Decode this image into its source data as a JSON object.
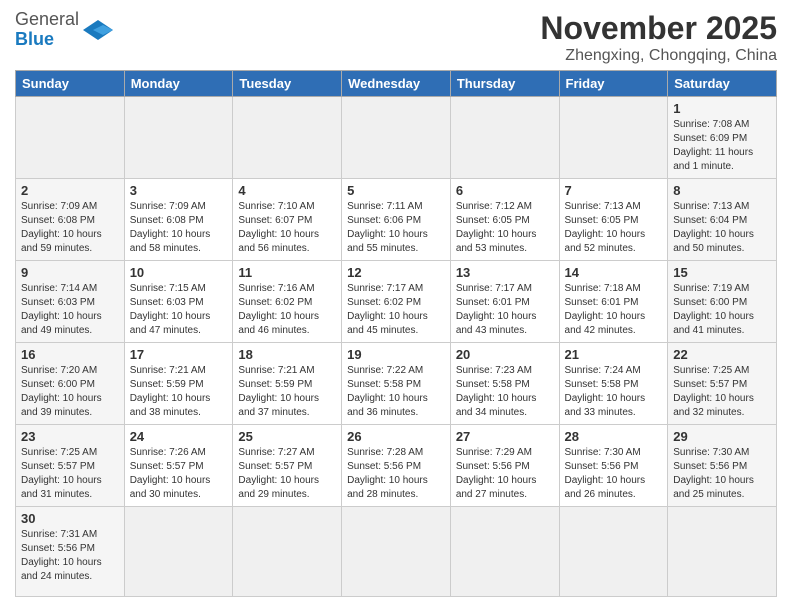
{
  "header": {
    "logo_general": "General",
    "logo_blue": "Blue",
    "title": "November 2025",
    "subtitle": "Zhengxing, Chongqing, China"
  },
  "days_of_week": [
    "Sunday",
    "Monday",
    "Tuesday",
    "Wednesday",
    "Thursday",
    "Friday",
    "Saturday"
  ],
  "weeks": [
    [
      {
        "num": "",
        "info": ""
      },
      {
        "num": "",
        "info": ""
      },
      {
        "num": "",
        "info": ""
      },
      {
        "num": "",
        "info": ""
      },
      {
        "num": "",
        "info": ""
      },
      {
        "num": "",
        "info": ""
      },
      {
        "num": "1",
        "info": "Sunrise: 7:08 AM\nSunset: 6:09 PM\nDaylight: 11 hours\nand 1 minute."
      }
    ],
    [
      {
        "num": "2",
        "info": "Sunrise: 7:09 AM\nSunset: 6:08 PM\nDaylight: 10 hours\nand 59 minutes."
      },
      {
        "num": "3",
        "info": "Sunrise: 7:09 AM\nSunset: 6:08 PM\nDaylight: 10 hours\nand 58 minutes."
      },
      {
        "num": "4",
        "info": "Sunrise: 7:10 AM\nSunset: 6:07 PM\nDaylight: 10 hours\nand 56 minutes."
      },
      {
        "num": "5",
        "info": "Sunrise: 7:11 AM\nSunset: 6:06 PM\nDaylight: 10 hours\nand 55 minutes."
      },
      {
        "num": "6",
        "info": "Sunrise: 7:12 AM\nSunset: 6:05 PM\nDaylight: 10 hours\nand 53 minutes."
      },
      {
        "num": "7",
        "info": "Sunrise: 7:13 AM\nSunset: 6:05 PM\nDaylight: 10 hours\nand 52 minutes."
      },
      {
        "num": "8",
        "info": "Sunrise: 7:13 AM\nSunset: 6:04 PM\nDaylight: 10 hours\nand 50 minutes."
      }
    ],
    [
      {
        "num": "9",
        "info": "Sunrise: 7:14 AM\nSunset: 6:03 PM\nDaylight: 10 hours\nand 49 minutes."
      },
      {
        "num": "10",
        "info": "Sunrise: 7:15 AM\nSunset: 6:03 PM\nDaylight: 10 hours\nand 47 minutes."
      },
      {
        "num": "11",
        "info": "Sunrise: 7:16 AM\nSunset: 6:02 PM\nDaylight: 10 hours\nand 46 minutes."
      },
      {
        "num": "12",
        "info": "Sunrise: 7:17 AM\nSunset: 6:02 PM\nDaylight: 10 hours\nand 45 minutes."
      },
      {
        "num": "13",
        "info": "Sunrise: 7:17 AM\nSunset: 6:01 PM\nDaylight: 10 hours\nand 43 minutes."
      },
      {
        "num": "14",
        "info": "Sunrise: 7:18 AM\nSunset: 6:01 PM\nDaylight: 10 hours\nand 42 minutes."
      },
      {
        "num": "15",
        "info": "Sunrise: 7:19 AM\nSunset: 6:00 PM\nDaylight: 10 hours\nand 41 minutes."
      }
    ],
    [
      {
        "num": "16",
        "info": "Sunrise: 7:20 AM\nSunset: 6:00 PM\nDaylight: 10 hours\nand 39 minutes."
      },
      {
        "num": "17",
        "info": "Sunrise: 7:21 AM\nSunset: 5:59 PM\nDaylight: 10 hours\nand 38 minutes."
      },
      {
        "num": "18",
        "info": "Sunrise: 7:21 AM\nSunset: 5:59 PM\nDaylight: 10 hours\nand 37 minutes."
      },
      {
        "num": "19",
        "info": "Sunrise: 7:22 AM\nSunset: 5:58 PM\nDaylight: 10 hours\nand 36 minutes."
      },
      {
        "num": "20",
        "info": "Sunrise: 7:23 AM\nSunset: 5:58 PM\nDaylight: 10 hours\nand 34 minutes."
      },
      {
        "num": "21",
        "info": "Sunrise: 7:24 AM\nSunset: 5:58 PM\nDaylight: 10 hours\nand 33 minutes."
      },
      {
        "num": "22",
        "info": "Sunrise: 7:25 AM\nSunset: 5:57 PM\nDaylight: 10 hours\nand 32 minutes."
      }
    ],
    [
      {
        "num": "23",
        "info": "Sunrise: 7:25 AM\nSunset: 5:57 PM\nDaylight: 10 hours\nand 31 minutes."
      },
      {
        "num": "24",
        "info": "Sunrise: 7:26 AM\nSunset: 5:57 PM\nDaylight: 10 hours\nand 30 minutes."
      },
      {
        "num": "25",
        "info": "Sunrise: 7:27 AM\nSunset: 5:57 PM\nDaylight: 10 hours\nand 29 minutes."
      },
      {
        "num": "26",
        "info": "Sunrise: 7:28 AM\nSunset: 5:56 PM\nDaylight: 10 hours\nand 28 minutes."
      },
      {
        "num": "27",
        "info": "Sunrise: 7:29 AM\nSunset: 5:56 PM\nDaylight: 10 hours\nand 27 minutes."
      },
      {
        "num": "28",
        "info": "Sunrise: 7:30 AM\nSunset: 5:56 PM\nDaylight: 10 hours\nand 26 minutes."
      },
      {
        "num": "29",
        "info": "Sunrise: 7:30 AM\nSunset: 5:56 PM\nDaylight: 10 hours\nand 25 minutes."
      }
    ],
    [
      {
        "num": "30",
        "info": "Sunrise: 7:31 AM\nSunset: 5:56 PM\nDaylight: 10 hours\nand 24 minutes."
      },
      {
        "num": "",
        "info": ""
      },
      {
        "num": "",
        "info": ""
      },
      {
        "num": "",
        "info": ""
      },
      {
        "num": "",
        "info": ""
      },
      {
        "num": "",
        "info": ""
      },
      {
        "num": "",
        "info": ""
      }
    ]
  ]
}
